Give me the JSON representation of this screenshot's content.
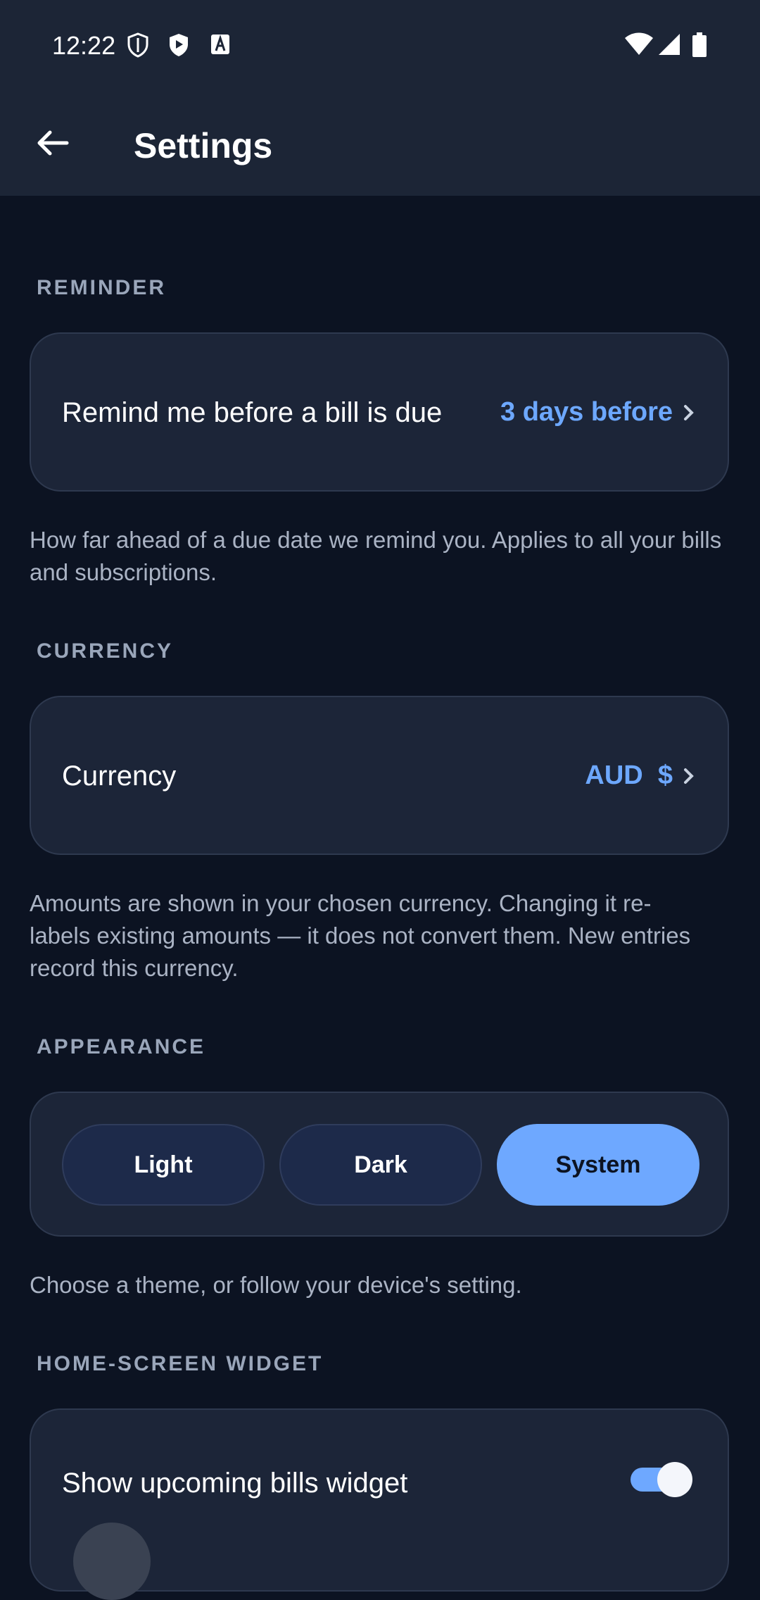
{
  "status_bar": {
    "time": "12:22",
    "icons": [
      "shield-outline-icon",
      "play-shield-icon",
      "font-a-icon",
      "wifi-icon",
      "signal-icon",
      "battery-icon"
    ]
  },
  "top_bar": {
    "back_icon": "arrow-left-icon",
    "title": "Settings"
  },
  "reminder": {
    "section_label": "REMINDER",
    "label": "Remind me before a bill is due",
    "value": "3 days before",
    "helper": "How far ahead of a due date we remind you. Applies to all your bills and subscriptions."
  },
  "currency": {
    "section_label": "CURRENCY",
    "label": "Currency",
    "value": "AUD  $",
    "helper": "Amounts are shown in your chosen currency. Changing it re-labels existing amounts — it does not convert them. New entries record this currency."
  },
  "appearance": {
    "section_label": "APPEARANCE",
    "options": [
      "Light",
      "Dark",
      "System"
    ],
    "selected": "System",
    "helper": "Choose a theme, or follow your device's setting."
  },
  "widget": {
    "section_label": "HOME-SCREEN WIDGET",
    "label": "Show upcoming bills widget",
    "enabled": true
  },
  "colors": {
    "background": "#0c1322",
    "bar": "#1c2536",
    "card": "#1c2538",
    "accent": "#6ea8ff",
    "muted_text": "#aab3c4"
  }
}
